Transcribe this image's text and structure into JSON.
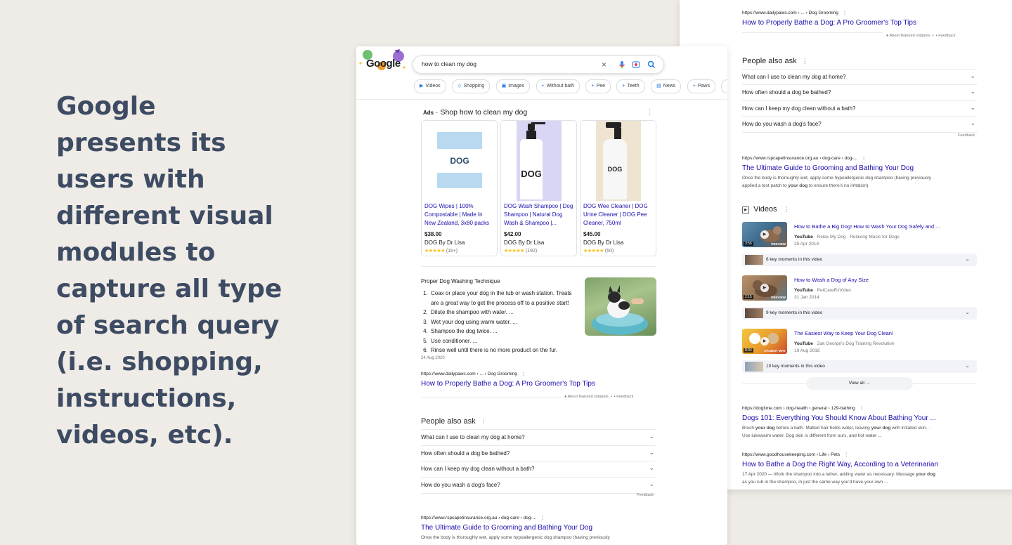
{
  "headline": "Google presents its users with different visual modules to capture all type of search query (i.e. shopping, instructions, videos, etc).",
  "colors": {
    "background": "#efebe6",
    "headline": "#3d4b63",
    "link": "#1a0dab",
    "accent": "#1a73e8"
  },
  "search": {
    "query": "how to clean my dog",
    "chips": [
      {
        "icon": "video-icon",
        "label": "Videos"
      },
      {
        "icon": "tag-icon",
        "label": "Shopping"
      },
      {
        "icon": "image-icon",
        "label": "Images"
      },
      {
        "icon": "plus-icon",
        "label": "Without bath"
      },
      {
        "icon": "plus-icon",
        "label": "Pee"
      },
      {
        "icon": "plus-icon",
        "label": "Teeth"
      },
      {
        "icon": "news-icon",
        "label": "News"
      },
      {
        "icon": "plus-icon",
        "label": "Paws"
      }
    ]
  },
  "ads": {
    "label": "Ads",
    "title": "· Shop how to clean my dog",
    "products": [
      {
        "title": "DOG Wipes | 100% Compostable | Made In New Zealand, 3x80 packs",
        "price": "$38.00",
        "seller": "DOG By Dr Lisa",
        "rating": "(1k+)",
        "brand": "DOG"
      },
      {
        "title": "DOG Wash Shampoo | Dog Shampoo | Natural Dog Wash & Shampoo |...",
        "price": "$42.00",
        "seller": "DOG By Dr Lisa",
        "rating": "(192)",
        "brand": "DOG"
      },
      {
        "title": "DOG Wee Cleaner | DOG Urine Cleaner | DOG Pee Cleaner, 750ml",
        "price": "$45.00",
        "seller": "DOG By Dr Lisa",
        "rating": "(60)",
        "brand": "DOG"
      }
    ]
  },
  "snippet": {
    "title": "Proper Dog Washing Technique",
    "steps": [
      "Coax or place your dog in the tub or wash station. Treats are a great way to get the process off to a positive start!",
      "Dilute the shampoo with water. ...",
      "Wet your dog using warm water. ...",
      "Shampoo the dog twice. ...",
      "Use conditioner. ...",
      "Rinse well until there is no more product on the fur."
    ],
    "date": "24 Aug 2020",
    "url": "https://www.dailypaws.com › ... › Dog Grooming",
    "link": "How to Properly Bathe a Dog: A Pro Groomer's Top Tips",
    "about": "About featured snippets",
    "feedback": "Feedback"
  },
  "paa": {
    "title": "People also ask",
    "questions": [
      "What can I use to clean my dog at home?",
      "How often should a dog be bathed?",
      "How can I keep my dog clean without a bath?",
      "How do you wash a dog's face?"
    ],
    "feedback": "Feedback"
  },
  "rspca": {
    "url": "https://www.rspcapetinsurance.org.au › dog-care › dog-...",
    "link": "The Ultimate Guide to Grooming and Bathing Your Dog",
    "desc_a": "Once the body is thoroughly wet, apply some hypoallergenic dog shampoo (having previously",
    "desc_b": "applied a test patch to ",
    "desc_bold": "your dog",
    "desc_c": " to ensure there's no irritation)."
  },
  "videos": {
    "title": "Videos",
    "items": [
      {
        "title": "How to Bathe a Big Dog! How to Wash Your Dog Safely and ...",
        "platform": "YouTube",
        "channel": "· Relax My Dog - Relaxing Music for Dogs",
        "date": "25 Apr 2018",
        "duration": "3:56",
        "badge": "PREVIEW",
        "moments": "6 key moments in this video"
      },
      {
        "title": "How to Wash a Dog of Any Size",
        "platform": "YouTube",
        "channel": "· PetCareRxVideo",
        "date": "31 Jan 2014",
        "duration": "2:15",
        "badge": "PREVIEW",
        "moments": "9 key moments in this video"
      },
      {
        "title": "The Easiest Way to Keep Your Dog Clean!",
        "platform": "YouTube",
        "channel": "· Zak George's Dog Training Revolution",
        "date": "19 Aug 2018",
        "duration": "8:34",
        "badge": "EASIEST WAY",
        "moments": "10 key moments in this video"
      }
    ],
    "view_all": "View all"
  },
  "dogtime": {
    "url": "https://dogtime.com › dog-health › general › 129-bathing",
    "link": "Dogs 101: Everything You Should Know About Bathing Your ...",
    "desc_a": "Brush ",
    "desc_bold": "your dog",
    "desc_b": " before a bath. Matted hair holds water, leaving ",
    "desc_bold2": "your dog",
    "desc_c": " with irritated skin. ·",
    "desc_d": "Use lukewarm water. Dog skin is different from ours, and hot water ..."
  },
  "goodhouse": {
    "url": "https://www.goodhousekeeping.com › Life › Pets",
    "link": "How to Bathe a Dog the Right Way, According to a Veterinarian",
    "desc_a": "17 Apr 2020 — Work the shampoo into a lather, adding water as necessary. Massage ",
    "desc_bold": "your dog",
    "desc_b": "as you rub in the shampoo, in just the same way you'd have your own ..."
  },
  "logo_text": "Google"
}
